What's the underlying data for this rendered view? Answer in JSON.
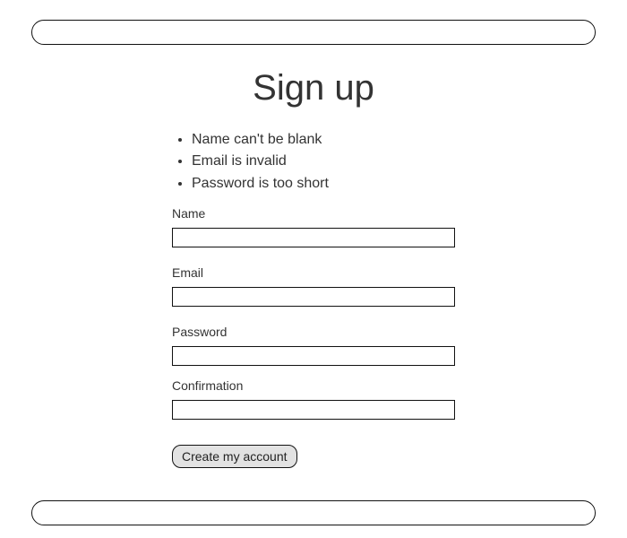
{
  "title": "Sign up",
  "errors": [
    "Name can't be blank",
    "Email is invalid",
    "Password is too short"
  ],
  "form": {
    "name": {
      "label": "Name",
      "value": ""
    },
    "email": {
      "label": "Email",
      "value": ""
    },
    "password": {
      "label": "Password",
      "value": ""
    },
    "confirmation": {
      "label": "Confirmation",
      "value": ""
    },
    "submit_label": "Create my account"
  }
}
